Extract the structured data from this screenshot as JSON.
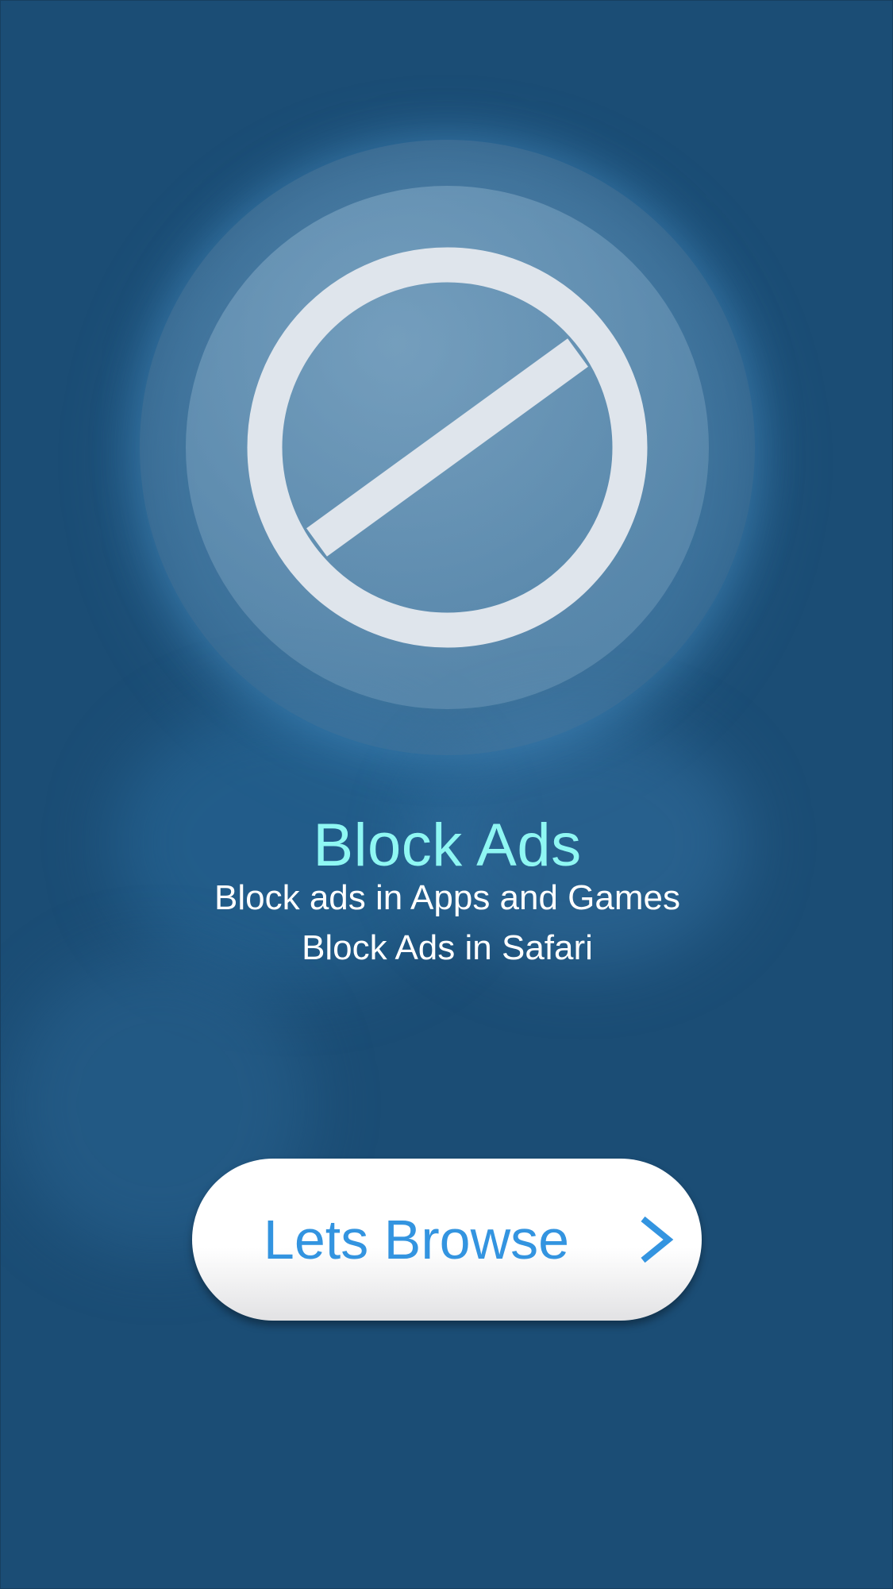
{
  "onboarding": {
    "title": "Block Ads",
    "subtitle_lines": [
      "Block ads in Apps and Games",
      "Block Ads in Safari"
    ]
  },
  "cta": {
    "label": "Lets Browse",
    "icon": "chevron-right-icon"
  },
  "hero": {
    "icon": "block-icon"
  },
  "colors": {
    "background": "#1b4d75",
    "title": "#8ff7f3",
    "subtitle": "#ffffff",
    "button_bg": "#ffffff",
    "button_text": "#3394e0",
    "icon": "#dfe5ec"
  }
}
